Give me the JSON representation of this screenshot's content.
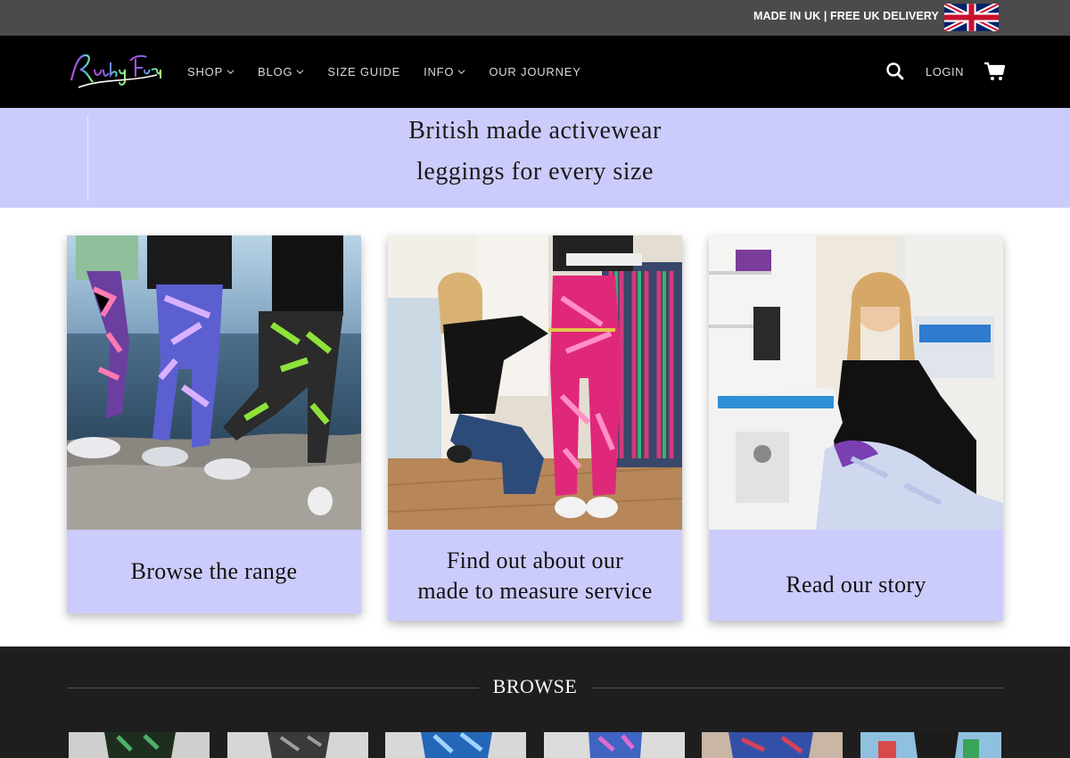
{
  "topbar": {
    "text": "MADE IN UK | FREE UK DELIVERY",
    "flag_icon": "uk-flag-icon"
  },
  "header": {
    "logo_text": "Ruby Fury",
    "nav": [
      {
        "label": "SHOP",
        "has_dropdown": true
      },
      {
        "label": "BLOG",
        "has_dropdown": true
      },
      {
        "label": "SIZE GUIDE",
        "has_dropdown": false
      },
      {
        "label": "INFO",
        "has_dropdown": true
      },
      {
        "label": "OUR JOURNEY",
        "has_dropdown": false
      }
    ],
    "login_label": "LOGIN",
    "search_icon": "search-icon",
    "cart_icon": "cart-icon"
  },
  "hero": {
    "line1": "British made activewear",
    "line2": "leggings for every size",
    "background": "#ccccfc"
  },
  "cards": [
    {
      "caption": "Browse the range",
      "image": "three women in patterned leggings standing on rocks by the sea"
    },
    {
      "caption_line1": "Find out about our",
      "caption_line2": "made to measure service",
      "image": "woman measuring a customer's waist in pink leggings"
    },
    {
      "caption": "Read our story",
      "image": "smiling woman sewing at an overlocker machine"
    }
  ],
  "browse": {
    "title": "BROWSE"
  },
  "colors": {
    "topbar": "#4b4b4b",
    "header": "#000000",
    "accent_lilac": "#ccccfc",
    "browse_bg": "#1e1e1e"
  }
}
